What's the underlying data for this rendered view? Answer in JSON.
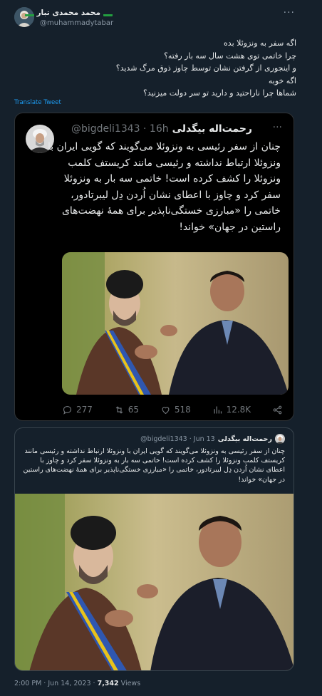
{
  "author": {
    "name": "محمد محمدی تبار",
    "handle": "@muhammadytabar"
  },
  "tweet": {
    "lines": [
      "اگه سفر به ونزوئلا بده",
      "چرا خاتمی توی هشت سال سه بار رفته؟",
      "و اینجوری از گرفتن نشان توسط چاوز ذوق مرگ شدید؟",
      "اگه خوبه",
      "شماها چرا ناراحتید و دارید تو سر دولت میزنید؟"
    ],
    "translate_label": "Translate Tweet",
    "timestamp": "2:00 PM · Jun 14, 2023 · ",
    "views_count": "7,342",
    "views_label": " Views"
  },
  "embedded_card": {
    "name": "رحمت‌اله بیگدلی",
    "handle": "@bigdeli1343 · 16h",
    "text": "چنان از سفر رئیسی به ونزوئلا می‌گویند که گویی ایران با ونزوئلا ارتباط نداشته و رئیسی مانند کریستف کلمب ونزوئلا را کشف کرده است! خاتمی سه بار به ونزوئلا سفر کرد و چاوز با اعطای نشان اُردن دِل لیبرتادور، خاتمی را «مبارزی خستگی‌ناپذیر برای همهٔ نهضت‌های راستین در جهان» خواند!",
    "stats": {
      "replies": "277",
      "retweets": "65",
      "likes": "518",
      "views": "12.8K"
    }
  },
  "quoted": {
    "name": "رحمت‌اله بیگدلی",
    "handle": "@bigdeli1343 · Jun 13",
    "text": "چنان از سفر رئیسی به ونزوئلا می‌گویند که گویی ایران با ونزوئلا ارتباط نداشته و رئیسی مانند کریستف کلمب ونزوئلا را کشف کرده است! خاتمی سه بار به ونزوئلا سفر کرد و چاوز با اعطای نشان اُردن دِل لیبرتادور، خاتمی را «مبارزی خستگی‌ناپذیر برای همهٔ نهضت‌های راستین در جهان» خواند!"
  },
  "icons": [
    "more-icon",
    "flag-icon",
    "reply-icon",
    "retweet-icon",
    "like-icon",
    "views-icon",
    "share-icon"
  ]
}
